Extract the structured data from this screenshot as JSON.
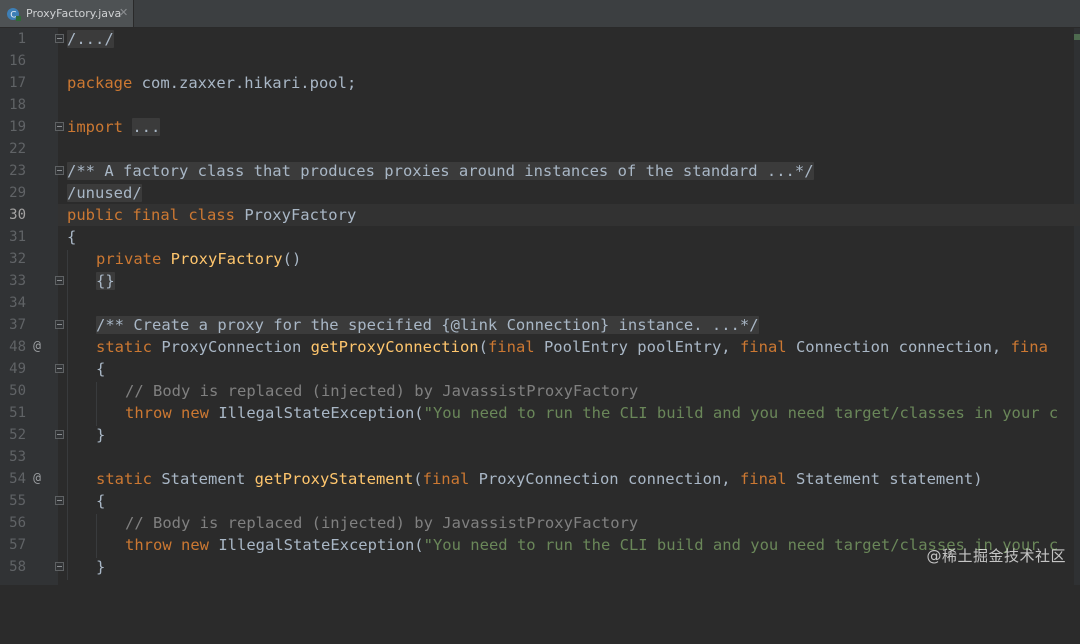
{
  "tab": {
    "file_name": "ProxyFactory.java"
  },
  "lines": [
    {
      "n": "1"
    },
    {
      "n": "16"
    },
    {
      "n": "17"
    },
    {
      "n": "18"
    },
    {
      "n": "19"
    },
    {
      "n": "22"
    },
    {
      "n": "23"
    },
    {
      "n": "29"
    },
    {
      "n": "30"
    },
    {
      "n": "31"
    },
    {
      "n": "32"
    },
    {
      "n": "33"
    },
    {
      "n": "34"
    },
    {
      "n": "37"
    },
    {
      "n": "48"
    },
    {
      "n": "49"
    },
    {
      "n": "50"
    },
    {
      "n": "51"
    },
    {
      "n": "52"
    },
    {
      "n": "53"
    },
    {
      "n": "54"
    },
    {
      "n": "55"
    },
    {
      "n": "56"
    },
    {
      "n": "57"
    },
    {
      "n": "58"
    }
  ],
  "code": {
    "l1_folded": "/.../",
    "l17_kw": "package",
    "l17_rest": " com.zaxxer.hikari.pool;",
    "l19_kw": "import",
    "l19_folded": "...",
    "l23_doc": "/** A factory class that produces proxies around instances of the standard ...*/",
    "l29_folded": "/unused/",
    "l30_kw": "public final class",
    "l30_name": " ProxyFactory",
    "l31": "{",
    "l32_kw": "private",
    "l32_fn": " ProxyFactory",
    "l32_rest": "()",
    "l33": "{}",
    "l37_doc": "/** Create a proxy for the specified {@link Connection} instance. ...*/",
    "l48_kw": "static",
    "l48_type": " ProxyConnection ",
    "l48_fn": "getProxyConnection",
    "l48_p1": "(",
    "l48_final1": "final",
    "l48_p2": " PoolEntry poolEntry, ",
    "l48_final2": "final",
    "l48_p3": " Connection connection, ",
    "l48_final3": "fina",
    "l49": "{",
    "l50_cm": "// Body is replaced (injected) by JavassistProxyFactory",
    "l51_kw": "throw new",
    "l51_cls": " IllegalStateException(",
    "l51_str": "\"You need to run the CLI build and you need target/classes in your c",
    "l52": "}",
    "l54_kw": "static",
    "l54_type": " Statement ",
    "l54_fn": "getProxyStatement",
    "l54_p1": "(",
    "l54_final1": "final",
    "l54_p2": " ProxyConnection connection, ",
    "l54_final2": "final",
    "l54_p3": " Statement statement)",
    "l55": "{",
    "l56_cm": "// Body is replaced (injected) by JavassistProxyFactory",
    "l57_kw": "throw new",
    "l57_cls": " IllegalStateException(",
    "l57_str": "\"You need to run the CLI build and you need target/classes in your c",
    "l58": "}"
  },
  "gutter_icons": {
    "override_marker": "@"
  },
  "watermark": "@稀土掘金技术社区",
  "colors": {
    "background": "#2b2b2b",
    "keyword": "#cc7832",
    "method": "#ffc66d",
    "comment": "#808080",
    "javadoc": "#629755",
    "string": "#6a8759",
    "text": "#a9b7c6"
  }
}
